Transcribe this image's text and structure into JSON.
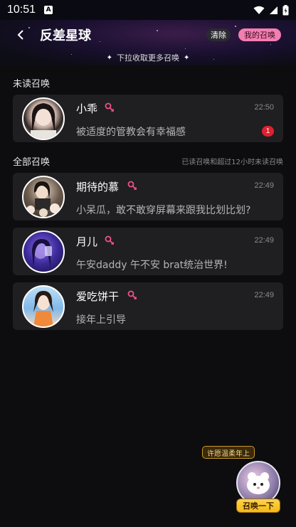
{
  "status": {
    "time": "10:51",
    "notif_glyph": "A"
  },
  "header": {
    "title": "反差星球",
    "clear_label": "清除",
    "mine_label": "我的召唤"
  },
  "pull_hint": "下拉收取更多召唤",
  "unread_section": {
    "title": "未读召唤"
  },
  "all_section": {
    "title": "全部召唤",
    "note": "已读召唤和超过12小时未读召唤"
  },
  "unread": [
    {
      "name": "小乖",
      "time": "22:50",
      "message": "被适度的管教会有幸福感",
      "badge": "1"
    }
  ],
  "all": [
    {
      "name": "期待的慕",
      "time": "22:49",
      "message": "小呆瓜，敢不敢穿屏幕来跟我比划比划?"
    },
    {
      "name": "月儿",
      "time": "22:49",
      "message": "午安daddy 午不安 brat统治世界!"
    },
    {
      "name": "爱吃饼干",
      "time": "22:49",
      "message": "接年上引导"
    }
  ],
  "float": {
    "tip": "许愿温柔年上",
    "button": "召唤一下"
  },
  "colors": {
    "accent_pink": "#f37fb0",
    "badge_red": "#e0202e",
    "card_bg": "#1f1f22",
    "gold": "#f4b818"
  }
}
